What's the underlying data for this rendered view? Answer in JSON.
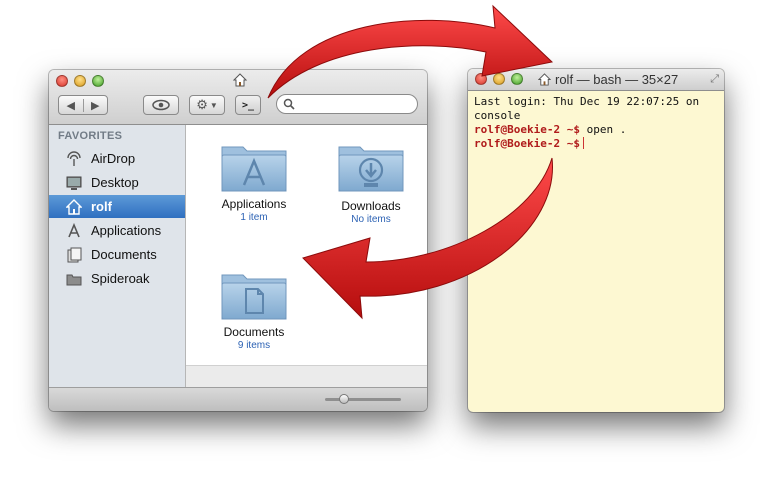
{
  "finder": {
    "sidebar": {
      "header": "FAVORITES",
      "items": [
        {
          "label": "AirDrop",
          "icon": "airdrop-icon"
        },
        {
          "label": "Desktop",
          "icon": "desktop-icon"
        },
        {
          "label": "rolf",
          "icon": "home-icon",
          "selected": true
        },
        {
          "label": "Applications",
          "icon": "applications-icon"
        },
        {
          "label": "Documents",
          "icon": "documents-icon"
        },
        {
          "label": "Spideroak",
          "icon": "folder-icon"
        }
      ]
    },
    "items": [
      {
        "name": "Applications",
        "count": "1 item",
        "icon": "applications-folder-icon"
      },
      {
        "name": "Downloads",
        "count": "No items",
        "icon": "downloads-folder-icon"
      },
      {
        "name": "Documents",
        "count": "9 items",
        "icon": "documents-folder-icon"
      }
    ],
    "search": {
      "placeholder": ""
    },
    "terminal_button_label": ">_"
  },
  "terminal": {
    "title": "rolf — bash — 35×27",
    "lines": {
      "line1": "Last login: Thu Dec 19 22:07:25 on",
      "line2": "console",
      "prompt1": "rolf@Boekie-2 ~$",
      "cmd1": " open .",
      "prompt2": "rolf@Boekie-2 ~$"
    }
  },
  "colors": {
    "arrow": "#d01818",
    "selection": "#2f6fc0",
    "terminal_bg": "#fdf8d2",
    "prompt": "#b01b1b"
  }
}
